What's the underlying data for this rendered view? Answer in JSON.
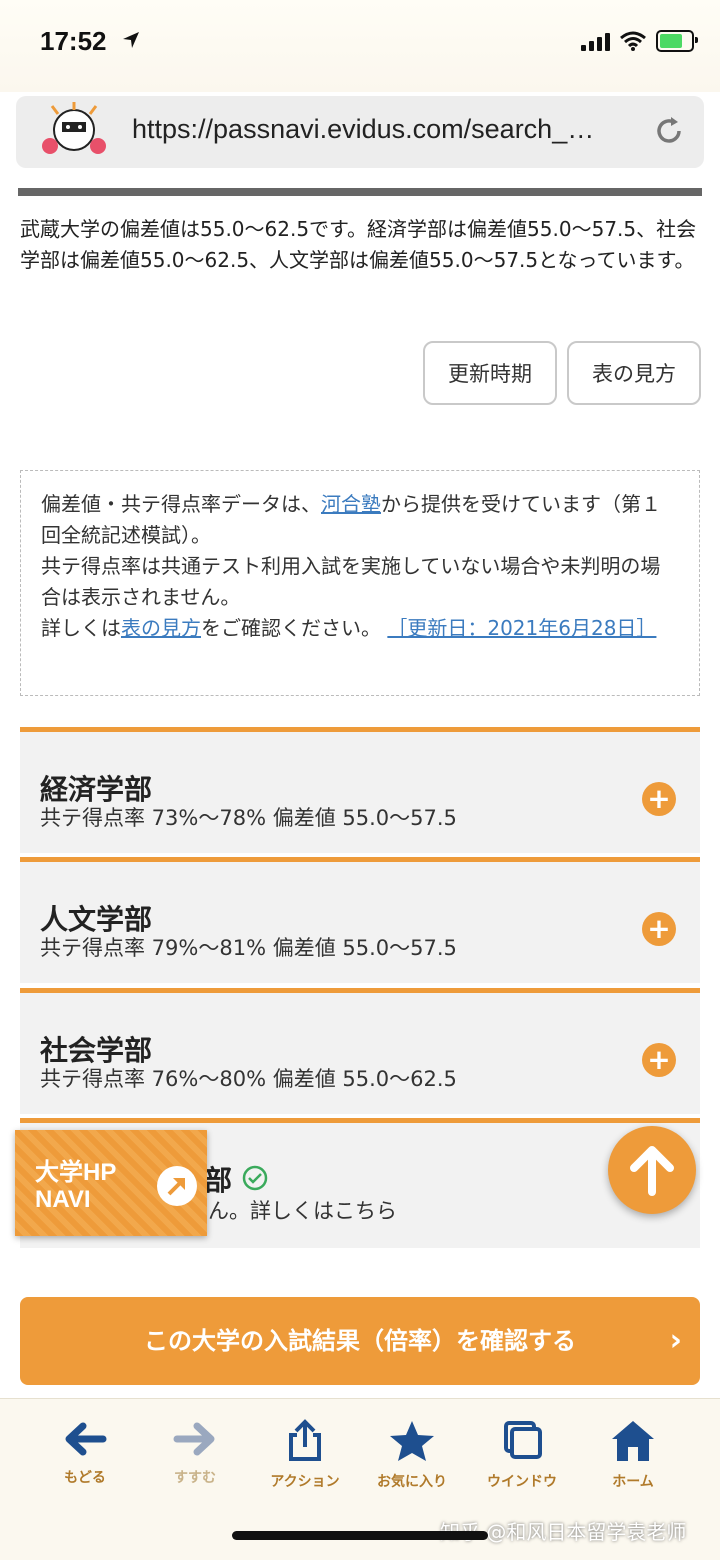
{
  "status_bar": {
    "time": "17:52"
  },
  "browser": {
    "url": "https://passnavi.evidus.com/search_…"
  },
  "intro_text": "武蔵大学の偏差値は55.0〜62.5です。経済学部は偏差値55.0〜57.5、社会学部は偏差値55.0〜62.5、人文学部は偏差値55.0〜57.5となっています。",
  "buttons": {
    "update_period": "更新時期",
    "how_to_read": "表の見方"
  },
  "notice": {
    "line1_pre": "偏差値・共テ得点率データは、",
    "line1_link": "河合塾",
    "line1_post": "から提供を受けています（第１回全統記述模試）。",
    "line2": "共テ得点率は共通テスト利用入試を実施していない場合や未判明の場合は表示されません。",
    "line3_pre": "詳しくは",
    "line3_link": "表の見方",
    "line3_post": "をご確認ください。",
    "update_link": "［更新日：2021年6月28日］"
  },
  "departments": [
    {
      "name": "経済学部",
      "stats": "共テ得点率 73%〜78% 偏差値 55.0〜57.5"
    },
    {
      "name": "人文学部",
      "stats": "共テ得点率 79%〜81% 偏差値 55.0〜57.5"
    },
    {
      "name": "社会学部",
      "stats": "共テ得点率 76%〜80% 偏差値 55.0〜62.5"
    }
  ],
  "partial_row": {
    "name_fragment": "部",
    "text_fragment": "ん。詳しくはこちら"
  },
  "hp_navi": {
    "line1": "大学HP",
    "line2": "NAVI"
  },
  "cta": {
    "label": "この大学の入試結果（倍率）を確認する",
    "chevron": "›"
  },
  "toolbar": {
    "items": [
      {
        "label": "もどる",
        "icon": "arrow-left-icon"
      },
      {
        "label": "すすむ",
        "icon": "arrow-right-icon"
      },
      {
        "label": "アクション",
        "icon": "share-icon"
      },
      {
        "label": "お気に入り",
        "icon": "star-icon"
      },
      {
        "label": "ウインドウ",
        "icon": "windows-icon"
      },
      {
        "label": "ホーム",
        "icon": "home-icon"
      }
    ]
  },
  "watermark": "知乎 @和风日本留学袁老师",
  "colors": {
    "accent": "#ee9b3a",
    "link": "#3b7bbf",
    "toolbar_icon": "#1e4f8f"
  }
}
